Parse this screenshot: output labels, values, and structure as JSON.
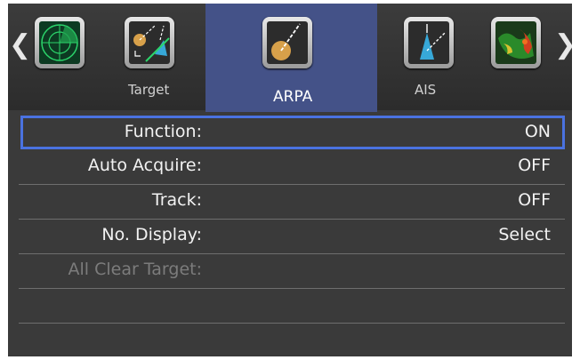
{
  "tabs": [
    {
      "label": "",
      "icon": "radar-sweep-icon"
    },
    {
      "label": "Target",
      "icon": "target-tracking-icon"
    },
    {
      "label": "ARPA",
      "icon": "arpa-vector-icon",
      "active": true
    },
    {
      "label": "AIS",
      "icon": "ais-vessel-icon"
    },
    {
      "label": "",
      "icon": "weather-echo-icon"
    }
  ],
  "nav": {
    "prev": "❮",
    "next": "❯"
  },
  "menu": [
    {
      "label": "Function:",
      "value": "ON",
      "selected": true
    },
    {
      "label": "Auto Acquire:",
      "value": "OFF"
    },
    {
      "label": "Track:",
      "value": "OFF"
    },
    {
      "label": "No. Display:",
      "value": "Select"
    },
    {
      "label": "All Clear Target:",
      "value": "",
      "disabled": true
    },
    {
      "label": "",
      "value": ""
    },
    {
      "label": "",
      "value": ""
    }
  ],
  "colors": {
    "active_tab": "#445288",
    "selection_border": "#4a72e0",
    "background": "#3a3a3a"
  }
}
